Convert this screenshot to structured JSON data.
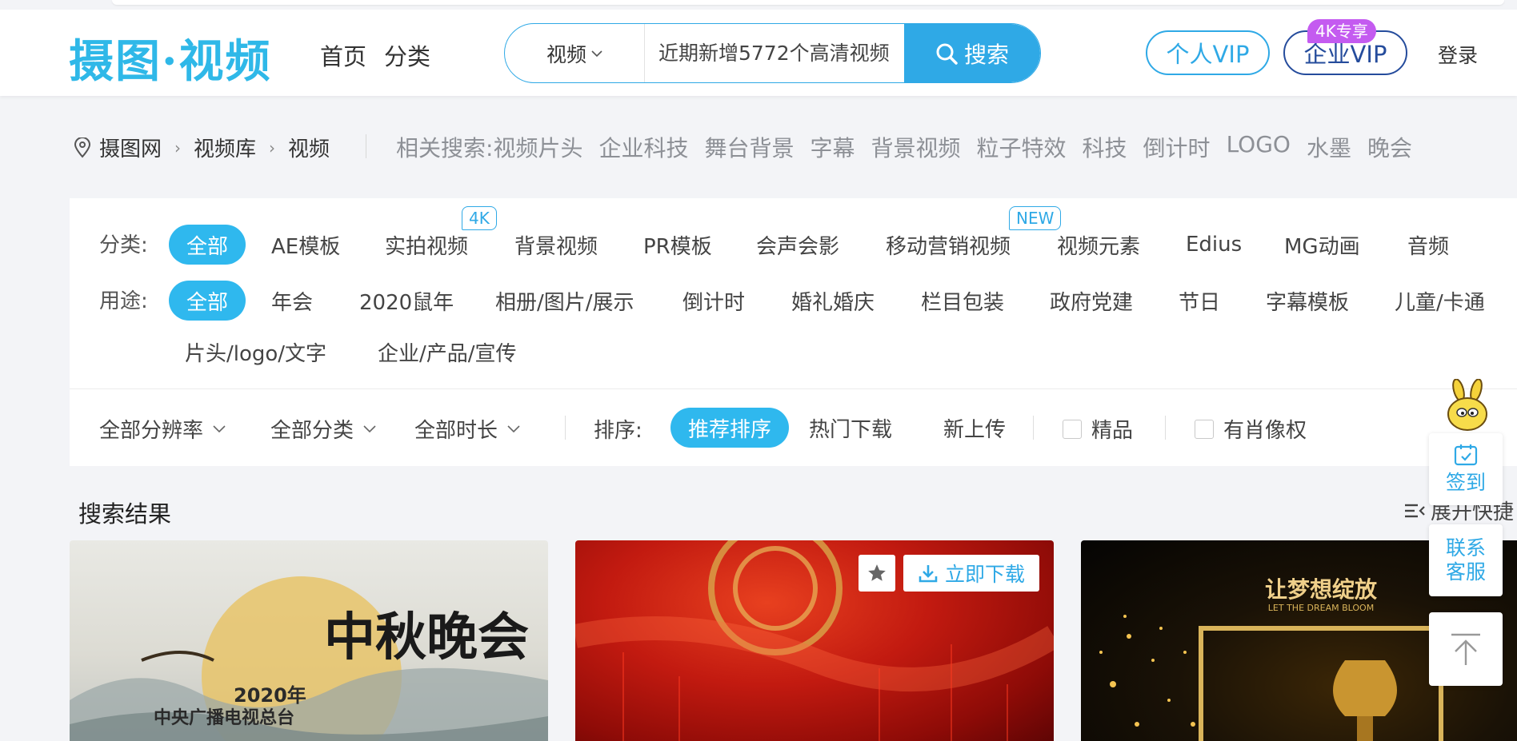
{
  "header": {
    "logo": "摄图·视频",
    "nav": [
      "首页",
      "分类"
    ],
    "search": {
      "type_label": "视频",
      "placeholder": "近期新增5772个高清视频",
      "button_label": "搜索"
    },
    "vip_personal": "个人VIP",
    "vip_enterprise": "企业VIP",
    "vip_badge": "4K专享",
    "login": "登录"
  },
  "breadcrumb": {
    "items": [
      "摄图网",
      "视频库",
      "视频"
    ],
    "related_label": "相关搜索:",
    "related": [
      "视频片头",
      "企业科技",
      "舞台背景",
      "字幕",
      "背景视频",
      "粒子特效",
      "科技",
      "倒计时",
      "LOGO",
      "水墨",
      "晚会"
    ]
  },
  "filters": {
    "category_label": "分类:",
    "categories": [
      "全部",
      "AE模板",
      "实拍视频",
      "背景视频",
      "PR模板",
      "会声会影",
      "移动营销视频",
      "视频元素",
      "Edius",
      "MG动画",
      "音频"
    ],
    "category_tags": {
      "tag_4k": "4K",
      "tag_new": "NEW"
    },
    "usage_label": "用途:",
    "usages": [
      "全部",
      "年会",
      "2020鼠年",
      "相册/图片/展示",
      "倒计时",
      "婚礼婚庆",
      "栏目包装",
      "政府党建",
      "节日",
      "字幕模板",
      "儿童/卡通",
      "片头/logo/文字",
      "企业/产品/宣传"
    ],
    "dropdowns": [
      "全部分辨率",
      "全部分类",
      "全部时长"
    ],
    "sort_label": "排序:",
    "sort_options": [
      "推荐排序",
      "热门下载",
      "新上传"
    ],
    "checkboxes": [
      "精品",
      "有肖像权"
    ]
  },
  "results": {
    "title": "搜索结果",
    "expand_label": "展开快捷",
    "cards": [
      {
        "caption_title": "中秋晚会",
        "caption_year": "2020年",
        "caption_org": "中央广播电视总台"
      },
      {
        "download_label": "立即下载"
      },
      {
        "caption_title": "让梦想绽放",
        "caption_sub": "LET THE DREAM BLOOM"
      }
    ]
  },
  "floating": {
    "checkin": "签到",
    "service": "联系客服"
  },
  "colors": {
    "brand": "#2fa9e6",
    "active_chip": "#2fb8ee",
    "enterprise": "#254c9c",
    "badge_purple": "#c45bf0"
  }
}
